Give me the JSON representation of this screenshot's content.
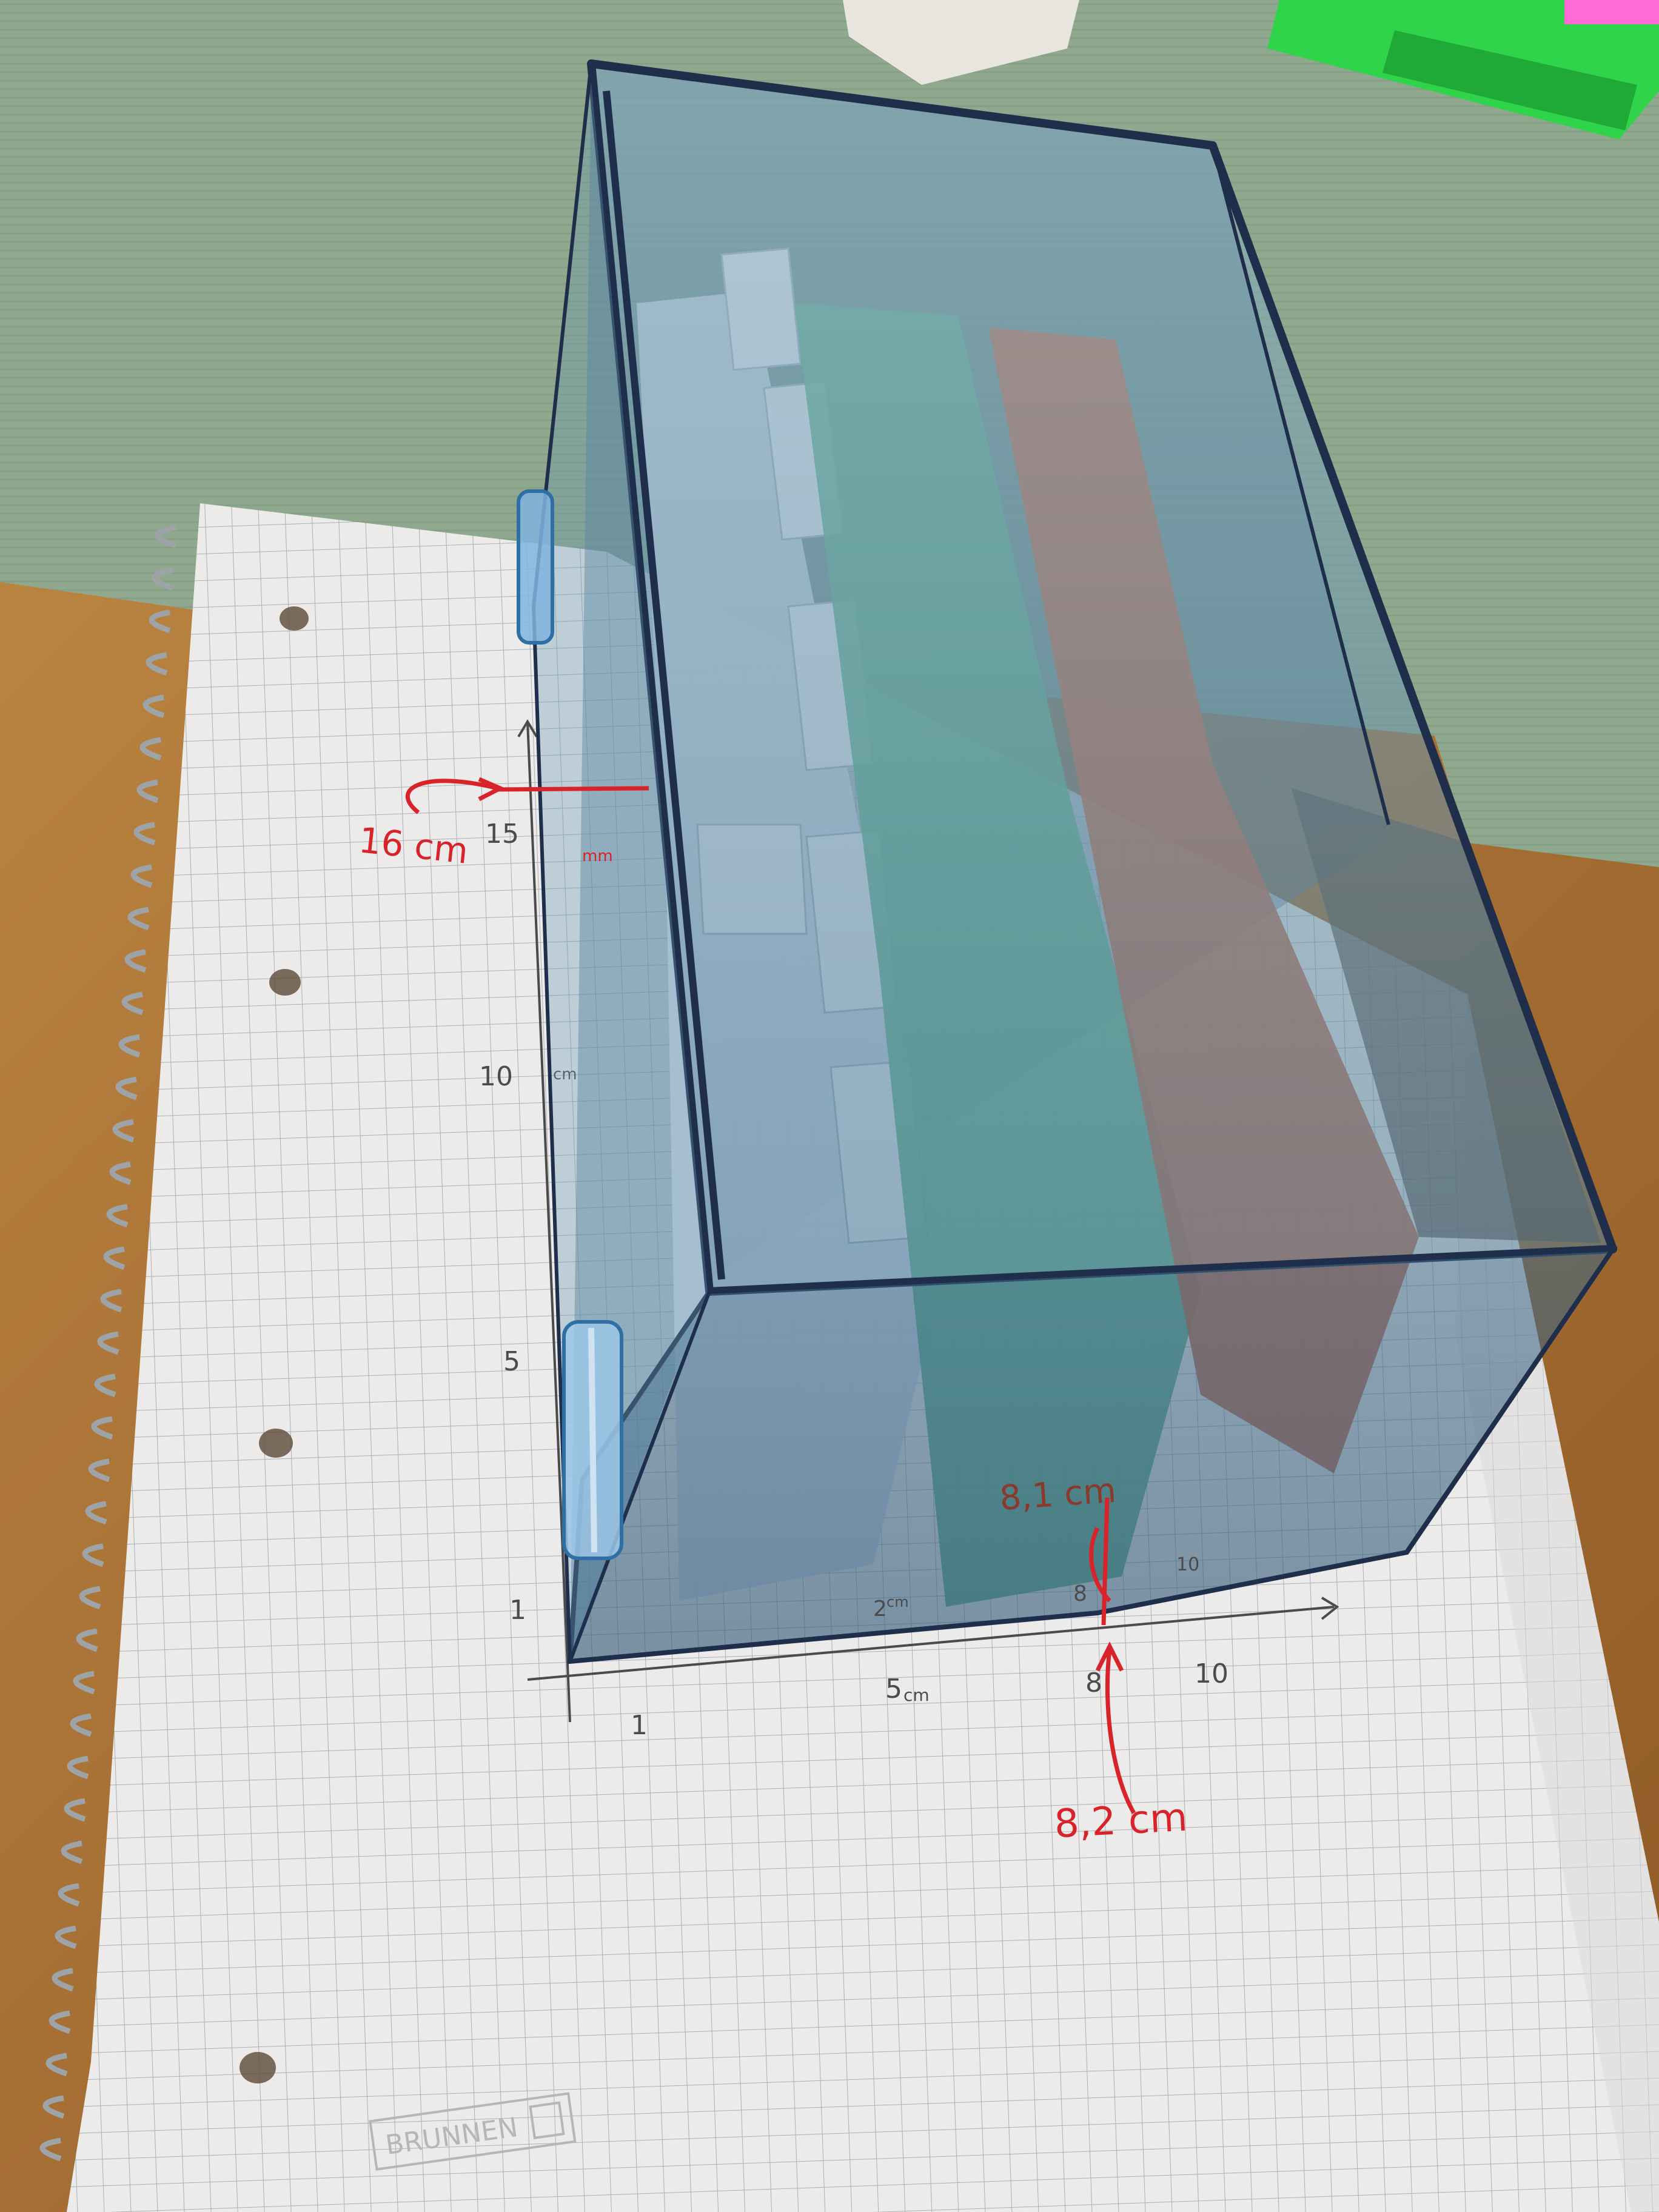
{
  "scene": {
    "objects": [
      "desk",
      "green-mat",
      "spiral-notebook",
      "transparent-blue-index-card-box",
      "index-cards-white",
      "index-cards-green",
      "index-cards-orange",
      "green-highlighter",
      "brunnen-logo"
    ]
  },
  "annotations": {
    "red": {
      "height_label": "16 cm",
      "width_label": "8,2 cm",
      "inner_width_label": "8,1 cm",
      "small_label": "mm"
    },
    "axis_y": {
      "tick_15": "15",
      "tick_10": "10",
      "tick_10_unit": "cm",
      "tick_5": "5",
      "tick_1": "1"
    },
    "axis_x": {
      "tick_1": "1",
      "tick_5": "5",
      "tick_5_unit": "cm",
      "tick_8": "8",
      "tick_10": "10",
      "inner_2": "2",
      "inner_2_unit": "cm",
      "inner_8": "8",
      "inner_10": "10"
    },
    "brand": "BRUNNEN"
  },
  "colors": {
    "mat": "#8fa88e",
    "desk": "#b07a3c",
    "paper": "#ecebea",
    "grid": "#a9b0b8",
    "red_ink": "#d8232a",
    "pencil": "#4b4b4b",
    "box_blue": "#5b86a3",
    "box_edge": "#1f2e4a",
    "card_white": "#c9d6e4",
    "card_green": "#5fae8e",
    "card_orange": "#c26a4a",
    "highlighter": "#2fd44a"
  }
}
